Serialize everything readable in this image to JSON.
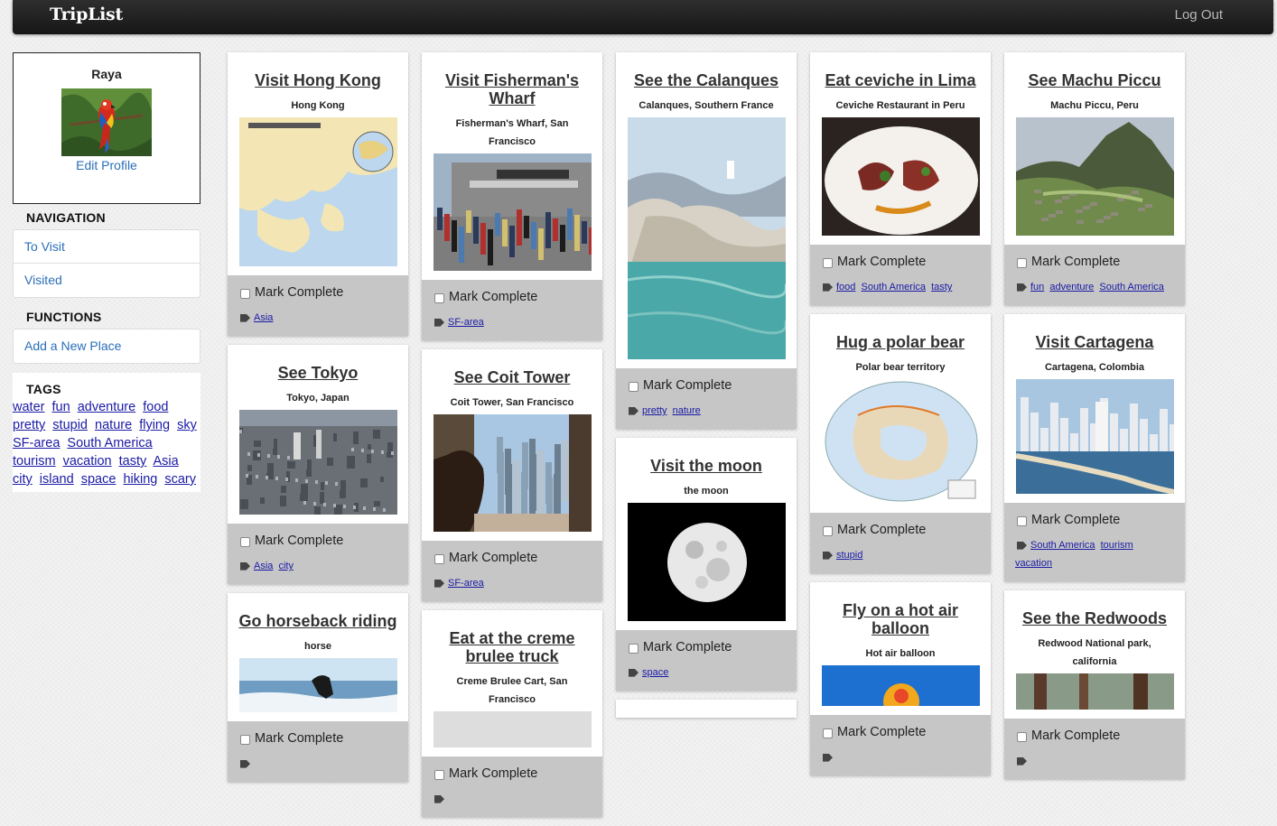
{
  "header": {
    "brand": "TripList",
    "logout": "Log Out"
  },
  "profile": {
    "name": "Raya",
    "edit_label": "Edit Profile"
  },
  "navigation": {
    "heading": "NAVIGATION",
    "items": [
      "To Visit",
      "Visited"
    ]
  },
  "functions": {
    "heading": "FUNCTIONS",
    "items": [
      "Add a New Place"
    ]
  },
  "tags": {
    "heading": "TAGS",
    "items": [
      "water",
      "fun",
      "adventure",
      "food",
      "pretty",
      "stupid",
      "nature",
      "flying",
      "sky",
      "SF-area",
      "South America",
      "tourism",
      "vacation",
      "tasty",
      "Asia",
      "city",
      "island",
      "space",
      "hiking",
      "scary"
    ]
  },
  "mark_label": "Mark Complete",
  "columns": [
    [
      {
        "title": "Visit Hong Kong",
        "location": "Hong Kong",
        "image": "hong-kong-map",
        "tags": [
          "Asia"
        ]
      },
      {
        "title": "See Tokyo",
        "location": "Tokyo, Japan",
        "image": "tokyo-aerial",
        "tags": [
          "Asia",
          "city"
        ]
      },
      {
        "title": "Go horseback riding",
        "location": "horse",
        "image": "horse-beach",
        "tags": []
      }
    ],
    [
      {
        "title": "Visit Fisherman's Wharf",
        "location": "Fisherman's Wharf, San Francisco",
        "image": "alcatraz-pier",
        "tags": [
          "SF-area"
        ]
      },
      {
        "title": "See Coit Tower",
        "location": "Coit Tower, San Francisco",
        "image": "coit-tower-view",
        "tags": [
          "SF-area"
        ]
      },
      {
        "title": "Eat at the creme brulee truck",
        "location": "Creme Brulee Cart, San Francisco",
        "image": "creme-brulee",
        "tags": []
      }
    ],
    [
      {
        "title": "See the Calanques",
        "location": "Calanques, Southern France",
        "image": "calanques-cliffs",
        "tags": [
          "pretty",
          "nature"
        ]
      },
      {
        "title": "Visit the moon",
        "location": "the moon",
        "image": "full-moon",
        "tags": [
          "space"
        ]
      },
      {
        "title": "",
        "location": "",
        "image": "",
        "tags": []
      }
    ],
    [
      {
        "title": "Eat ceviche in Lima",
        "location": "Ceviche Restaurant in Peru",
        "image": "ceviche-plate",
        "tags": [
          "food",
          "South America",
          "tasty"
        ]
      },
      {
        "title": "Hug a polar bear",
        "location": "Polar bear territory",
        "image": "polar-map",
        "tags": [
          "stupid"
        ]
      },
      {
        "title": "Fly on a hot air balloon",
        "location": "Hot air balloon",
        "image": "hot-air-balloon",
        "tags": []
      }
    ],
    [
      {
        "title": "See Machu Piccu",
        "location": "Machu Piccu, Peru",
        "image": "machu-picchu",
        "tags": [
          "fun",
          "adventure",
          "South America"
        ]
      },
      {
        "title": "Visit Cartagena",
        "location": "Cartagena, Colombia",
        "image": "cartagena-skyline",
        "tags": [
          "South America",
          "tourism",
          "vacation"
        ]
      },
      {
        "title": "See the Redwoods",
        "location": "Redwood National park, california",
        "image": "redwood-forest",
        "tags": []
      }
    ]
  ]
}
